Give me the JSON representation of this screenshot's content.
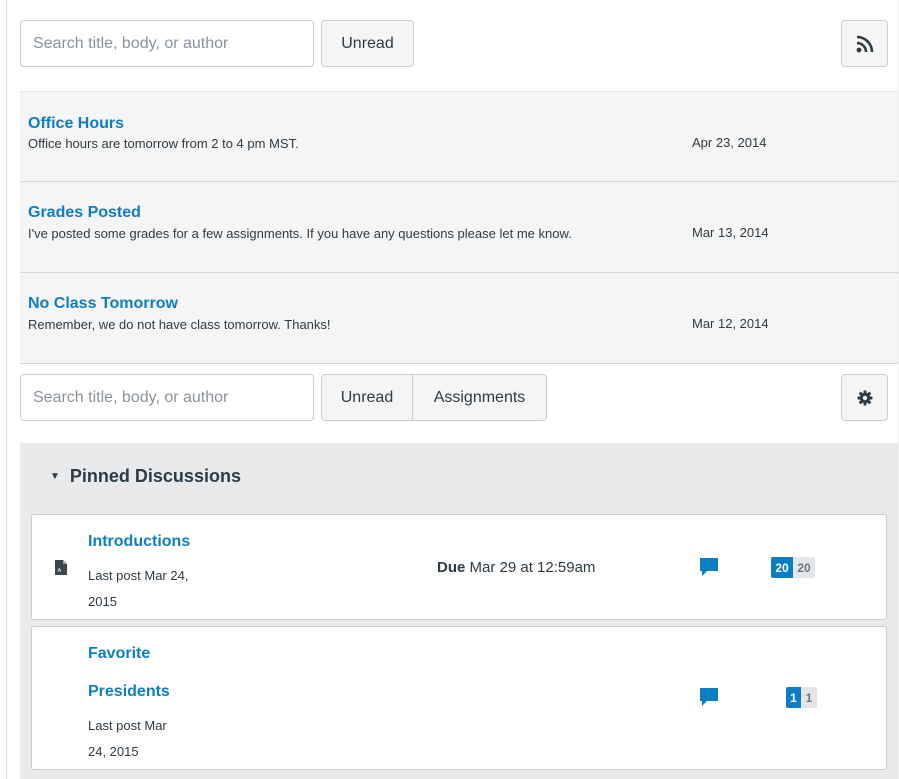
{
  "announcements_toolbar": {
    "search_placeholder": "Search title, body, or author",
    "unread_label": "Unread",
    "rss_icon": "rss-icon"
  },
  "announcements": [
    {
      "title": "Office Hours",
      "body": "Office hours are tomorrow from 2 to 4 pm MST.",
      "date": "Apr 23, 2014"
    },
    {
      "title": "Grades Posted",
      "body": "I've posted some grades for a few assignments. If you have any questions please let me know.",
      "date": "Mar 13, 2014"
    },
    {
      "title": "No Class Tomorrow",
      "body": "Remember, we do not have class tomorrow. Thanks!",
      "date": "Mar 12, 2014"
    }
  ],
  "discussions_toolbar": {
    "search_placeholder": "Search title, body, or author",
    "unread_label": "Unread",
    "assignments_label": "Assignments",
    "settings_icon": "gear-icon"
  },
  "pinned": {
    "header": "Pinned Discussions",
    "items": [
      {
        "title": "Introductions",
        "last_post_line1": "Last post Mar 24,",
        "last_post_line2": "2015",
        "due_label": "Due",
        "due_value": "Mar 29 at 12:59am",
        "unread_count": "20",
        "total_count": "20",
        "icon": "assignment-document-icon"
      },
      {
        "title_line1": "Favorite",
        "title_line2": "Presidents",
        "last_post_line1": "Last post Mar",
        "last_post_line2": "24, 2015",
        "unread_count": "1",
        "total_count": "1"
      }
    ]
  },
  "colors": {
    "link": "#0e7ec4",
    "badge_unread": "#0e7ec4",
    "panel_bg": "#e8eaec",
    "row_bg": "#f5f5f5"
  }
}
